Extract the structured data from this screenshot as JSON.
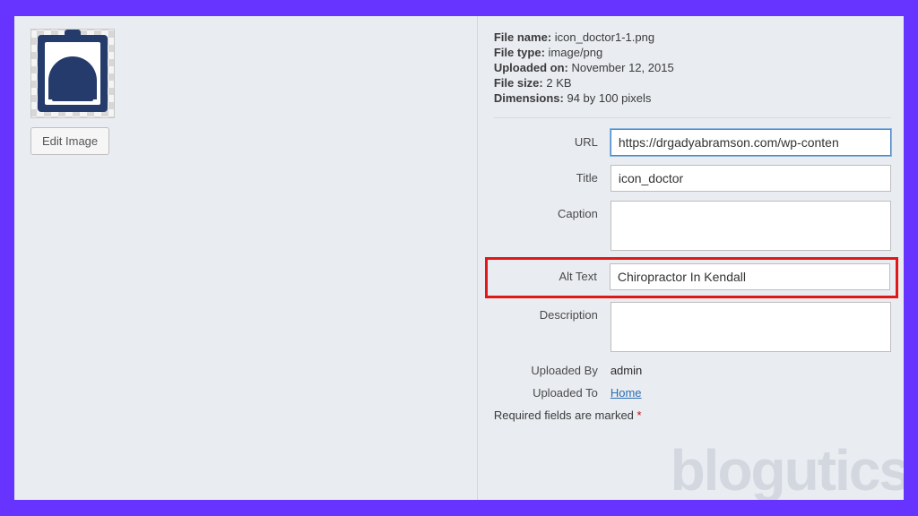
{
  "left": {
    "edit_image_label": "Edit Image"
  },
  "meta": {
    "file_name_label": "File name:",
    "file_name": "icon_doctor1-1.png",
    "file_type_label": "File type:",
    "file_type": "image/png",
    "uploaded_on_label": "Uploaded on:",
    "uploaded_on": "November 12, 2015",
    "file_size_label": "File size:",
    "file_size": "2 KB",
    "dimensions_label": "Dimensions:",
    "dimensions": "94 by 100 pixels"
  },
  "fields": {
    "url_label": "URL",
    "url_value": "https://drgadyabramson.com/wp-conten",
    "title_label": "Title",
    "title_value": "icon_doctor",
    "caption_label": "Caption",
    "caption_value": "",
    "alt_label": "Alt Text",
    "alt_value": "Chiropractor In Kendall",
    "description_label": "Description",
    "description_value": ""
  },
  "uploaded": {
    "by_label": "Uploaded By",
    "by_value": "admin",
    "to_label": "Uploaded To",
    "to_value": "Home"
  },
  "required_text": "Required fields are marked ",
  "required_mark": "*",
  "watermark": "blogutics"
}
